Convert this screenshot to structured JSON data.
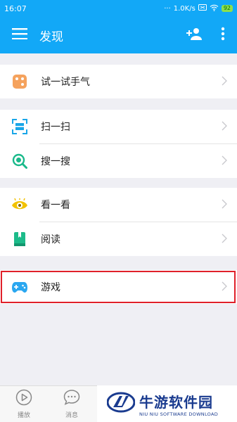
{
  "status_bar": {
    "time": "16:07",
    "network_speed": "1.0K/s",
    "battery": "92"
  },
  "app_bar": {
    "title": "发现",
    "menu_icon": "hamburger-icon",
    "add_friend_icon": "add-person-icon",
    "more_icon": "more-vert-icon"
  },
  "groups": [
    {
      "items": [
        {
          "label": "试一试手气",
          "icon": "dice-icon",
          "color": "#f5a25d"
        }
      ]
    },
    {
      "items": [
        {
          "label": "扫一扫",
          "icon": "scan-icon",
          "color": "#19a6e8"
        },
        {
          "label": "搜一搜",
          "icon": "search-icon",
          "color": "#19b98a"
        }
      ]
    },
    {
      "items": [
        {
          "label": "看一看",
          "icon": "eye-icon",
          "color": "#f2c200"
        },
        {
          "label": "阅读",
          "icon": "book-icon",
          "color": "#1dbb8a"
        }
      ]
    },
    {
      "items": [
        {
          "label": "游戏",
          "icon": "gamepad-icon",
          "color": "#2aa7f0"
        }
      ]
    }
  ],
  "bottom_nav": [
    {
      "label": "播放",
      "icon": "play-icon"
    },
    {
      "label": "消息",
      "icon": "message-icon"
    }
  ],
  "watermark": {
    "title": "牛游软件园",
    "subtitle": "NIU NIU SOFTWARE DOWNLOAD"
  },
  "colors": {
    "primary": "#12a8f7",
    "highlight": "#e0202a"
  }
}
